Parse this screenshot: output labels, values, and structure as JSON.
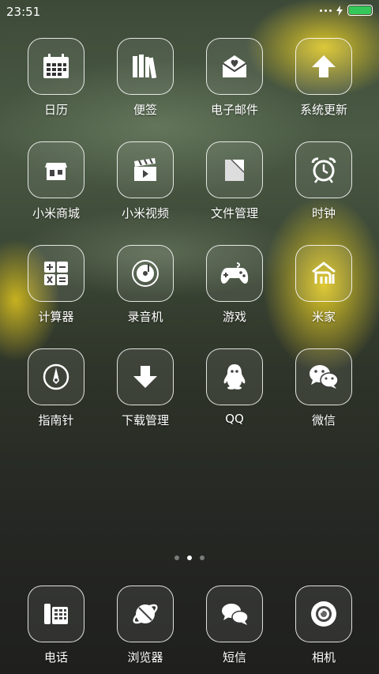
{
  "status": {
    "time": "23:51"
  },
  "apps": [
    {
      "label": "日历",
      "icon": "calendar-icon"
    },
    {
      "label": "便签",
      "icon": "books-icon"
    },
    {
      "label": "电子邮件",
      "icon": "mail-heart-icon"
    },
    {
      "label": "系统更新",
      "icon": "arrow-up-icon"
    },
    {
      "label": "小米商城",
      "icon": "store-icon"
    },
    {
      "label": "小米视频",
      "icon": "clapperboard-icon"
    },
    {
      "label": "文件管理",
      "icon": "folder-icon"
    },
    {
      "label": "时钟",
      "icon": "alarm-clock-icon"
    },
    {
      "label": "计算器",
      "icon": "calculator-icon"
    },
    {
      "label": "录音机",
      "icon": "recorder-icon"
    },
    {
      "label": "游戏",
      "icon": "gamepad-icon"
    },
    {
      "label": "米家",
      "icon": "mi-home-icon"
    },
    {
      "label": "指南针",
      "icon": "compass-icon"
    },
    {
      "label": "下载管理",
      "icon": "download-icon"
    },
    {
      "label": "QQ",
      "icon": "qq-penguin-icon"
    },
    {
      "label": "微信",
      "icon": "wechat-icon"
    }
  ],
  "dock": [
    {
      "label": "电话",
      "icon": "phone-icon"
    },
    {
      "label": "浏览器",
      "icon": "browser-planet-icon"
    },
    {
      "label": "短信",
      "icon": "messages-icon"
    },
    {
      "label": "相机",
      "icon": "camera-icon"
    }
  ],
  "pages": {
    "count": 3,
    "active": 2
  }
}
